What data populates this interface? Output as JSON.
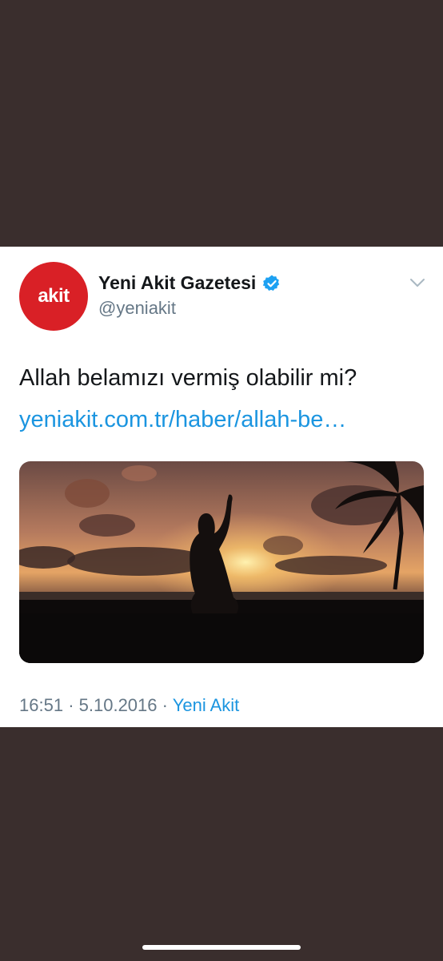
{
  "tweet": {
    "avatar_text": "akit",
    "display_name": "Yeni Akit Gazetesi",
    "handle": "@yeniakit",
    "text": "Allah belamızı vermiş olabilir mi?",
    "link": "yeniakit.com.tr/haber/allah-be…",
    "time": "16:51",
    "date": "5.10.2016",
    "separator": "·",
    "source": "Yeni Akit"
  },
  "icons": {
    "verified": "verified-badge-icon",
    "menu": "chevron-down-icon"
  },
  "colors": {
    "background": "#3a2e2d",
    "card": "#ffffff",
    "avatar": "#d92026",
    "link": "#1b95e0",
    "verified": "#1da1f2",
    "muted": "#657786"
  }
}
